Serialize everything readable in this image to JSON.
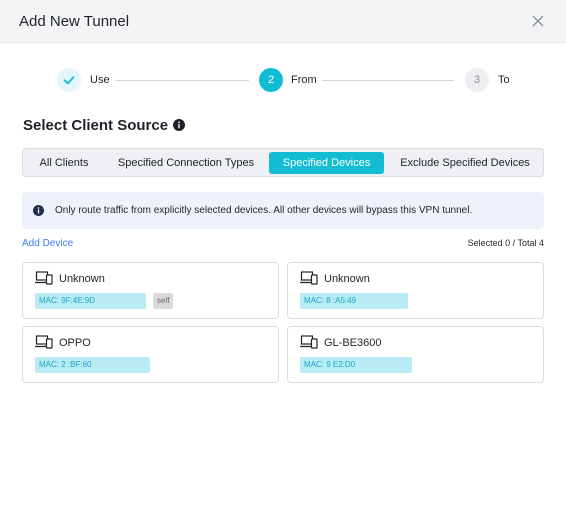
{
  "dialog": {
    "title": "Add New Tunnel"
  },
  "steps": [
    {
      "label": "Use",
      "number": "",
      "state": "done"
    },
    {
      "label": "From",
      "number": "2",
      "state": "active"
    },
    {
      "label": "To",
      "number": "3",
      "state": "pending"
    }
  ],
  "section": {
    "title": "Select Client Source"
  },
  "tabs": [
    {
      "label": "All Clients"
    },
    {
      "label": "Specified Connection Types"
    },
    {
      "label": "Specified Devices"
    },
    {
      "label": "Exclude Specified Devices"
    }
  ],
  "active_tab": "Specified Devices",
  "notice": {
    "text": "Only route traffic from explicitly selected devices. All other devices will bypass this VPN tunnel."
  },
  "add_device_label": "Add Device",
  "selected_count": "Selected 0 / Total 4",
  "devices": [
    {
      "name": "Unknown",
      "mac": "MAC:           9F:4E:9D",
      "self_label": "self"
    },
    {
      "name": "Unknown",
      "mac": "MAC: 8           :A5:49"
    },
    {
      "name": "OPPO",
      "mac": "MAC: 2            :BF:60"
    },
    {
      "name": "GL-BE3600",
      "mac": "MAC: 9            E2:D0"
    }
  ],
  "colors": {
    "accent": "#12bcd3",
    "link": "#3b7bf5",
    "mac_bg": "#b9ebf4",
    "notice_bg": "#eef2fd"
  },
  "icons": {
    "close": "close-icon",
    "check": "check-icon",
    "info": "info-icon",
    "device": "devices-icon"
  }
}
